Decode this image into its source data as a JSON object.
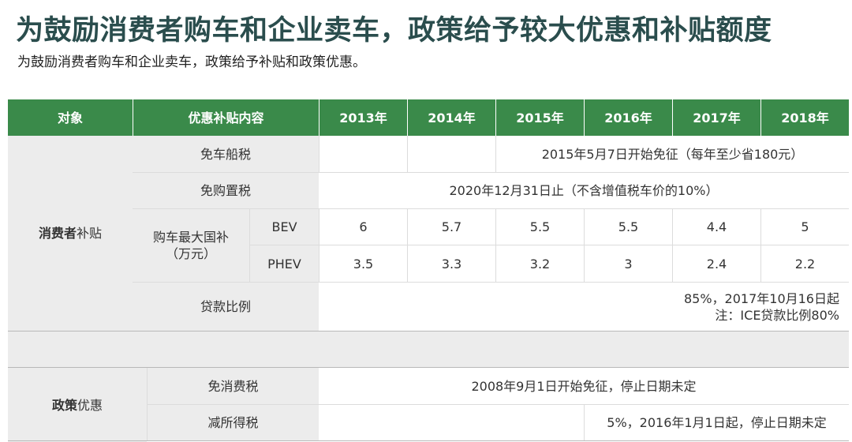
{
  "title": "为鼓励消费者购车和企业卖车，政策给予较大优惠和补贴额度",
  "subtitle": "为鼓励消费者购车和企业卖车，政策给予补贴和政策优惠。",
  "colors": {
    "header_green": "#3a8a4a",
    "title": "#2a4d4d",
    "label_bg": "#ececec"
  },
  "table": {
    "headers": [
      "对象",
      "优惠补贴内容",
      "2013年",
      "2014年",
      "2015年",
      "2016年",
      "2017年",
      "2018年"
    ],
    "consumer": {
      "group_bold": "消费者",
      "group_rest": "补贴",
      "vessel_tax": {
        "label": "免车船税",
        "value": "2015年5月7日开始免征（每年至少省180元）"
      },
      "purchase_tax": {
        "label": "免购置税",
        "value": "2020年12月31日止（不含增值税车价的10%）"
      },
      "subsidy": {
        "label_line1": "购车最大国补",
        "label_line2": "（万元）",
        "bev_label": "BEV",
        "bev_values": [
          "6",
          "5.7",
          "5.5",
          "5.5",
          "4.4",
          "5"
        ],
        "phev_label": "PHEV",
        "phev_values": [
          "3.5",
          "3.3",
          "3.2",
          "3",
          "2.4",
          "2.2"
        ]
      },
      "loan": {
        "label": "贷款比例",
        "line1": "85%，2017年10月16日起",
        "line2": "注：ICE贷款比例80%"
      }
    },
    "policy": {
      "group_bold": "政策",
      "group_rest": "优惠",
      "consumption_tax": {
        "label": "免消费税",
        "value": "2008年9月1日开始免征，停止日期未定"
      },
      "income_tax": {
        "label": "减所得税",
        "value": "5%，2016年1月1日起，停止日期未定"
      }
    }
  }
}
